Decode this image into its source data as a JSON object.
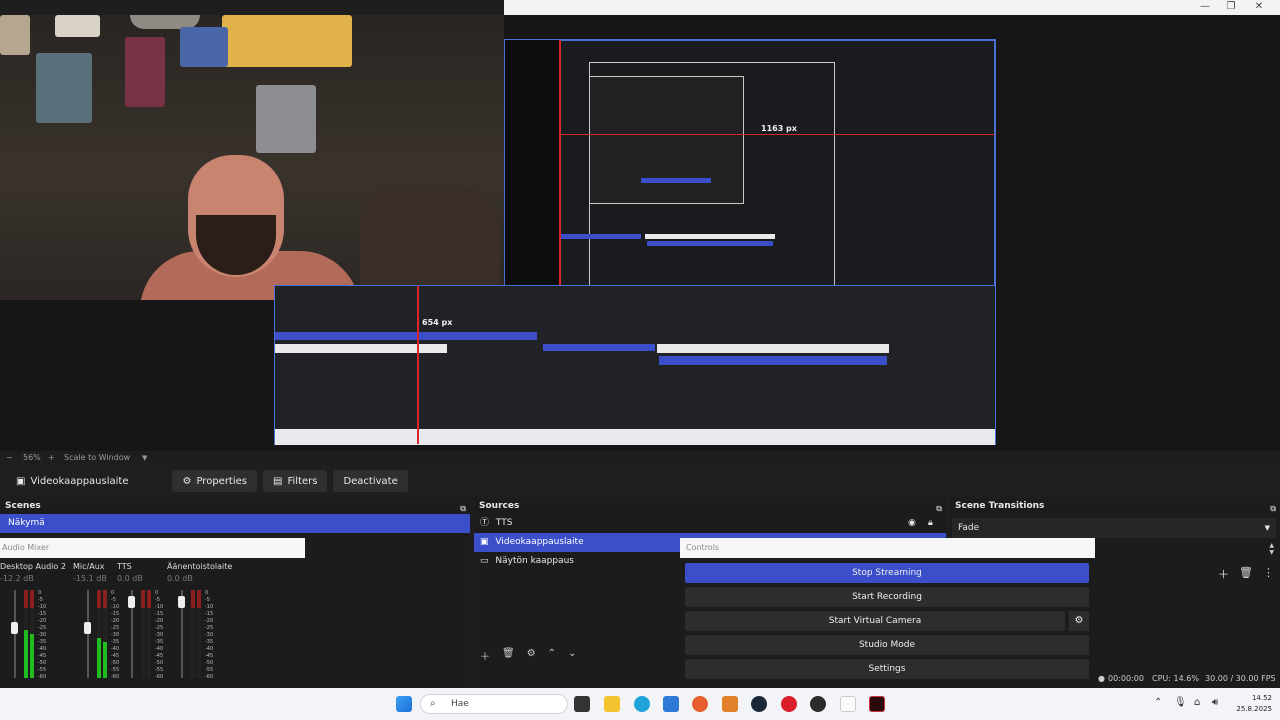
{
  "preview": {
    "measure_horizontal": "1163 px",
    "measure_vertical": "654 px"
  },
  "zoom": {
    "minus": "−",
    "level": "56%",
    "plus": "+",
    "mode": "Scale to Window",
    "caret": "▼"
  },
  "toolbar": {
    "source_name": "Videokaappauslaite",
    "properties_label": "Properties",
    "filters_label": "Filters",
    "deactivate_label": "Deactivate"
  },
  "scenes": {
    "title": "Scenes",
    "items": [
      {
        "label": "Näkymä"
      }
    ]
  },
  "sources": {
    "title": "Sources",
    "items": [
      {
        "label": "TTS",
        "icon": "text-icon"
      },
      {
        "label": "Videokaappauslaite",
        "icon": "camera-icon"
      },
      {
        "label": "Näytön kaappaus",
        "icon": "monitor-icon"
      }
    ]
  },
  "transitions": {
    "title": "Scene Transitions",
    "selected": "Fade"
  },
  "mixer": {
    "title": "Audio Mixer",
    "channels": [
      {
        "name": "Desktop Audio 2",
        "db": "-12.2 dB",
        "level": 0.55
      },
      {
        "name": "Mic/Aux",
        "db": "-15.1 dB",
        "level": 0.45
      },
      {
        "name": "TTS",
        "db": "0.0 dB",
        "level": 0.0
      },
      {
        "name": "Äänentoistolaite",
        "db": "0.0 dB",
        "level": 0.0
      }
    ],
    "scale": [
      "0",
      "-5",
      "-10",
      "-15",
      "-20",
      "-25",
      "-30",
      "-35",
      "-40",
      "-45",
      "-50",
      "-55",
      "-60"
    ]
  },
  "controls": {
    "title": "Controls",
    "stop_streaming": "Stop Streaming",
    "start_recording": "Start Recording",
    "start_virtual_camera": "Start Virtual Camera",
    "studio_mode": "Studio Mode",
    "settings": "Settings"
  },
  "status": {
    "rec_time": "00:00:00",
    "cpu": "CPU: 14.6%",
    "fps": "30.00 / 30.00 FPS"
  },
  "taskbar": {
    "search_placeholder": "Hae",
    "time": "14.52",
    "date": "25.8.2025"
  },
  "colors": {
    "accent": "#3a4fc9",
    "meter_green": "#1fbd1f",
    "meter_red": "#8a1f1f"
  }
}
